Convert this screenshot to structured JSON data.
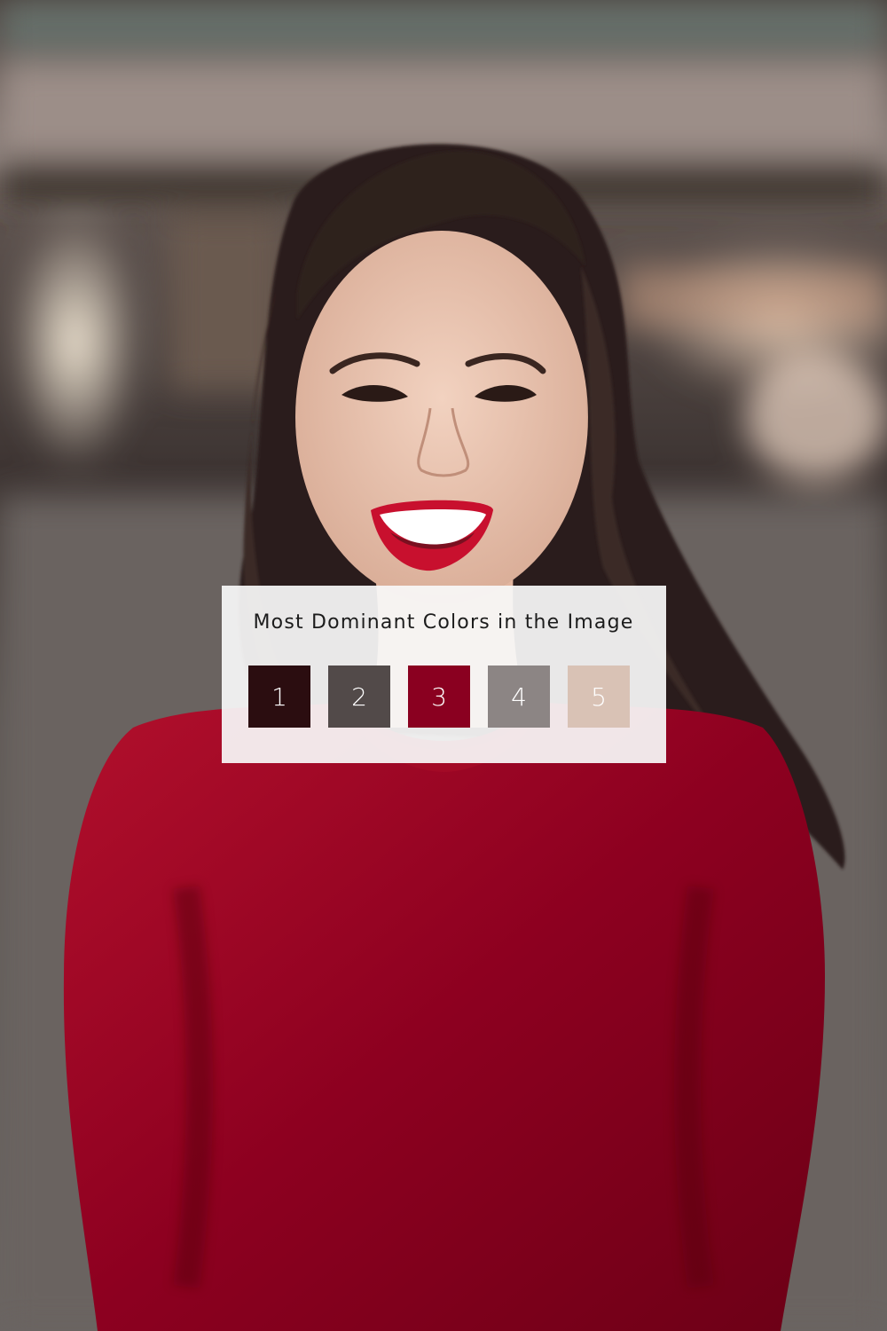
{
  "photo": {
    "subject": "smiling-woman-red-top",
    "background_tone": "#3c3432"
  },
  "palette": {
    "title": "Most Dominant Colors in the Image",
    "swatches": [
      {
        "label": "1",
        "color": "#2b0d10"
      },
      {
        "label": "2",
        "color": "#524a49"
      },
      {
        "label": "3",
        "color": "#8a0020"
      },
      {
        "label": "4",
        "color": "#8c8584"
      },
      {
        "label": "5",
        "color": "#d9c2b5"
      }
    ]
  }
}
